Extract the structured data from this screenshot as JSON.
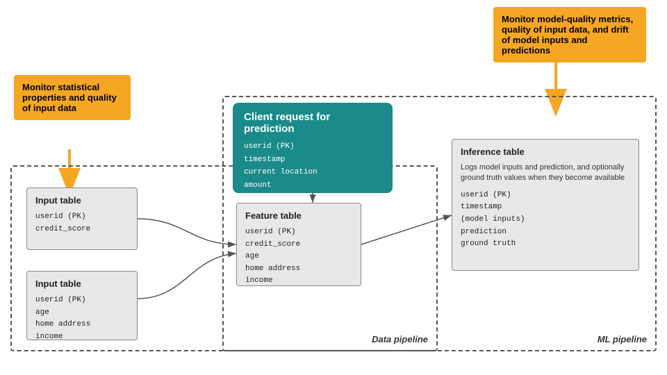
{
  "callout_left": {
    "text": "Monitor statistical properties and quality of input data"
  },
  "callout_right": {
    "text": "Monitor model-quality metrics, quality of input data, and drift of model inputs and predictions"
  },
  "data_pipeline_label": "Data pipeline",
  "ml_pipeline_label": "ML pipeline",
  "client_request": {
    "title": "Client request for prediction",
    "fields": [
      "userid (PK)",
      "timestamp",
      "current location",
      "amount"
    ]
  },
  "input_table_1": {
    "title": "Input table",
    "fields": [
      "userid (PK)",
      "credit_score"
    ]
  },
  "input_table_2": {
    "title": "Input table",
    "fields": [
      "userid (PK)",
      "age",
      "home address",
      "income"
    ]
  },
  "feature_table": {
    "title": "Feature table",
    "fields": [
      "userid (PK)",
      "credit_score",
      "age",
      "home address",
      "income"
    ]
  },
  "inference_table": {
    "title": "Inference table",
    "description": "Logs model inputs and prediction, and optionally ground truth values when they become available",
    "fields": [
      "userid (PK)",
      "timestamp",
      "(model inputs)",
      "prediction",
      "ground truth"
    ]
  }
}
